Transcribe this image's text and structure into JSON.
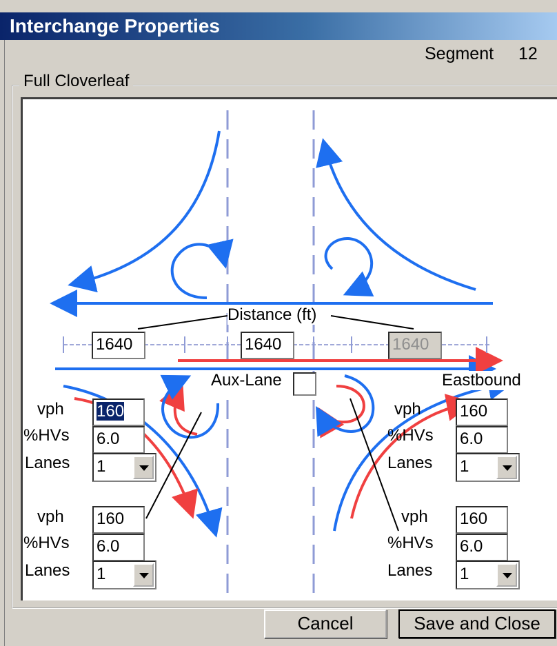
{
  "window": {
    "title": "Interchange Properties"
  },
  "segment": {
    "label": "Segment",
    "number": "12"
  },
  "group": {
    "label": "Full Cloverleaf"
  },
  "distance": {
    "label": "Distance (ft)",
    "fields": [
      {
        "value": "1640",
        "enabled": true
      },
      {
        "value": "1640",
        "enabled": true
      },
      {
        "value": "1640",
        "enabled": false
      }
    ]
  },
  "aux_lane": {
    "label": "Aux-Lane",
    "checked": false
  },
  "direction": {
    "label": "Eastbound"
  },
  "ramps": {
    "top_left": {
      "vph_label": "vph",
      "vph": "160",
      "hv_label": "%HVs",
      "hv": "6.0",
      "lanes_label": "Lanes",
      "lanes": "1"
    },
    "bottom_left": {
      "vph_label": "vph",
      "vph": "160",
      "hv_label": "%HVs",
      "hv": "6.0",
      "lanes_label": "Lanes",
      "lanes": "1"
    },
    "top_right": {
      "vph_label": "vph",
      "vph": "160",
      "hv_label": "%HVs",
      "hv": "6.0",
      "lanes_label": "Lanes",
      "lanes": "1"
    },
    "bottom_right": {
      "vph_label": "vph",
      "vph": "160",
      "hv_label": "%HVs",
      "hv": "6.0",
      "lanes_label": "Lanes",
      "lanes": "1"
    }
  },
  "buttons": {
    "cancel": "Cancel",
    "save": "Save and Close"
  },
  "colors": {
    "blue": "#1e6ff0",
    "red": "#f04040",
    "dashed": "#8f9bd6",
    "title_bar": "#0a246a"
  }
}
